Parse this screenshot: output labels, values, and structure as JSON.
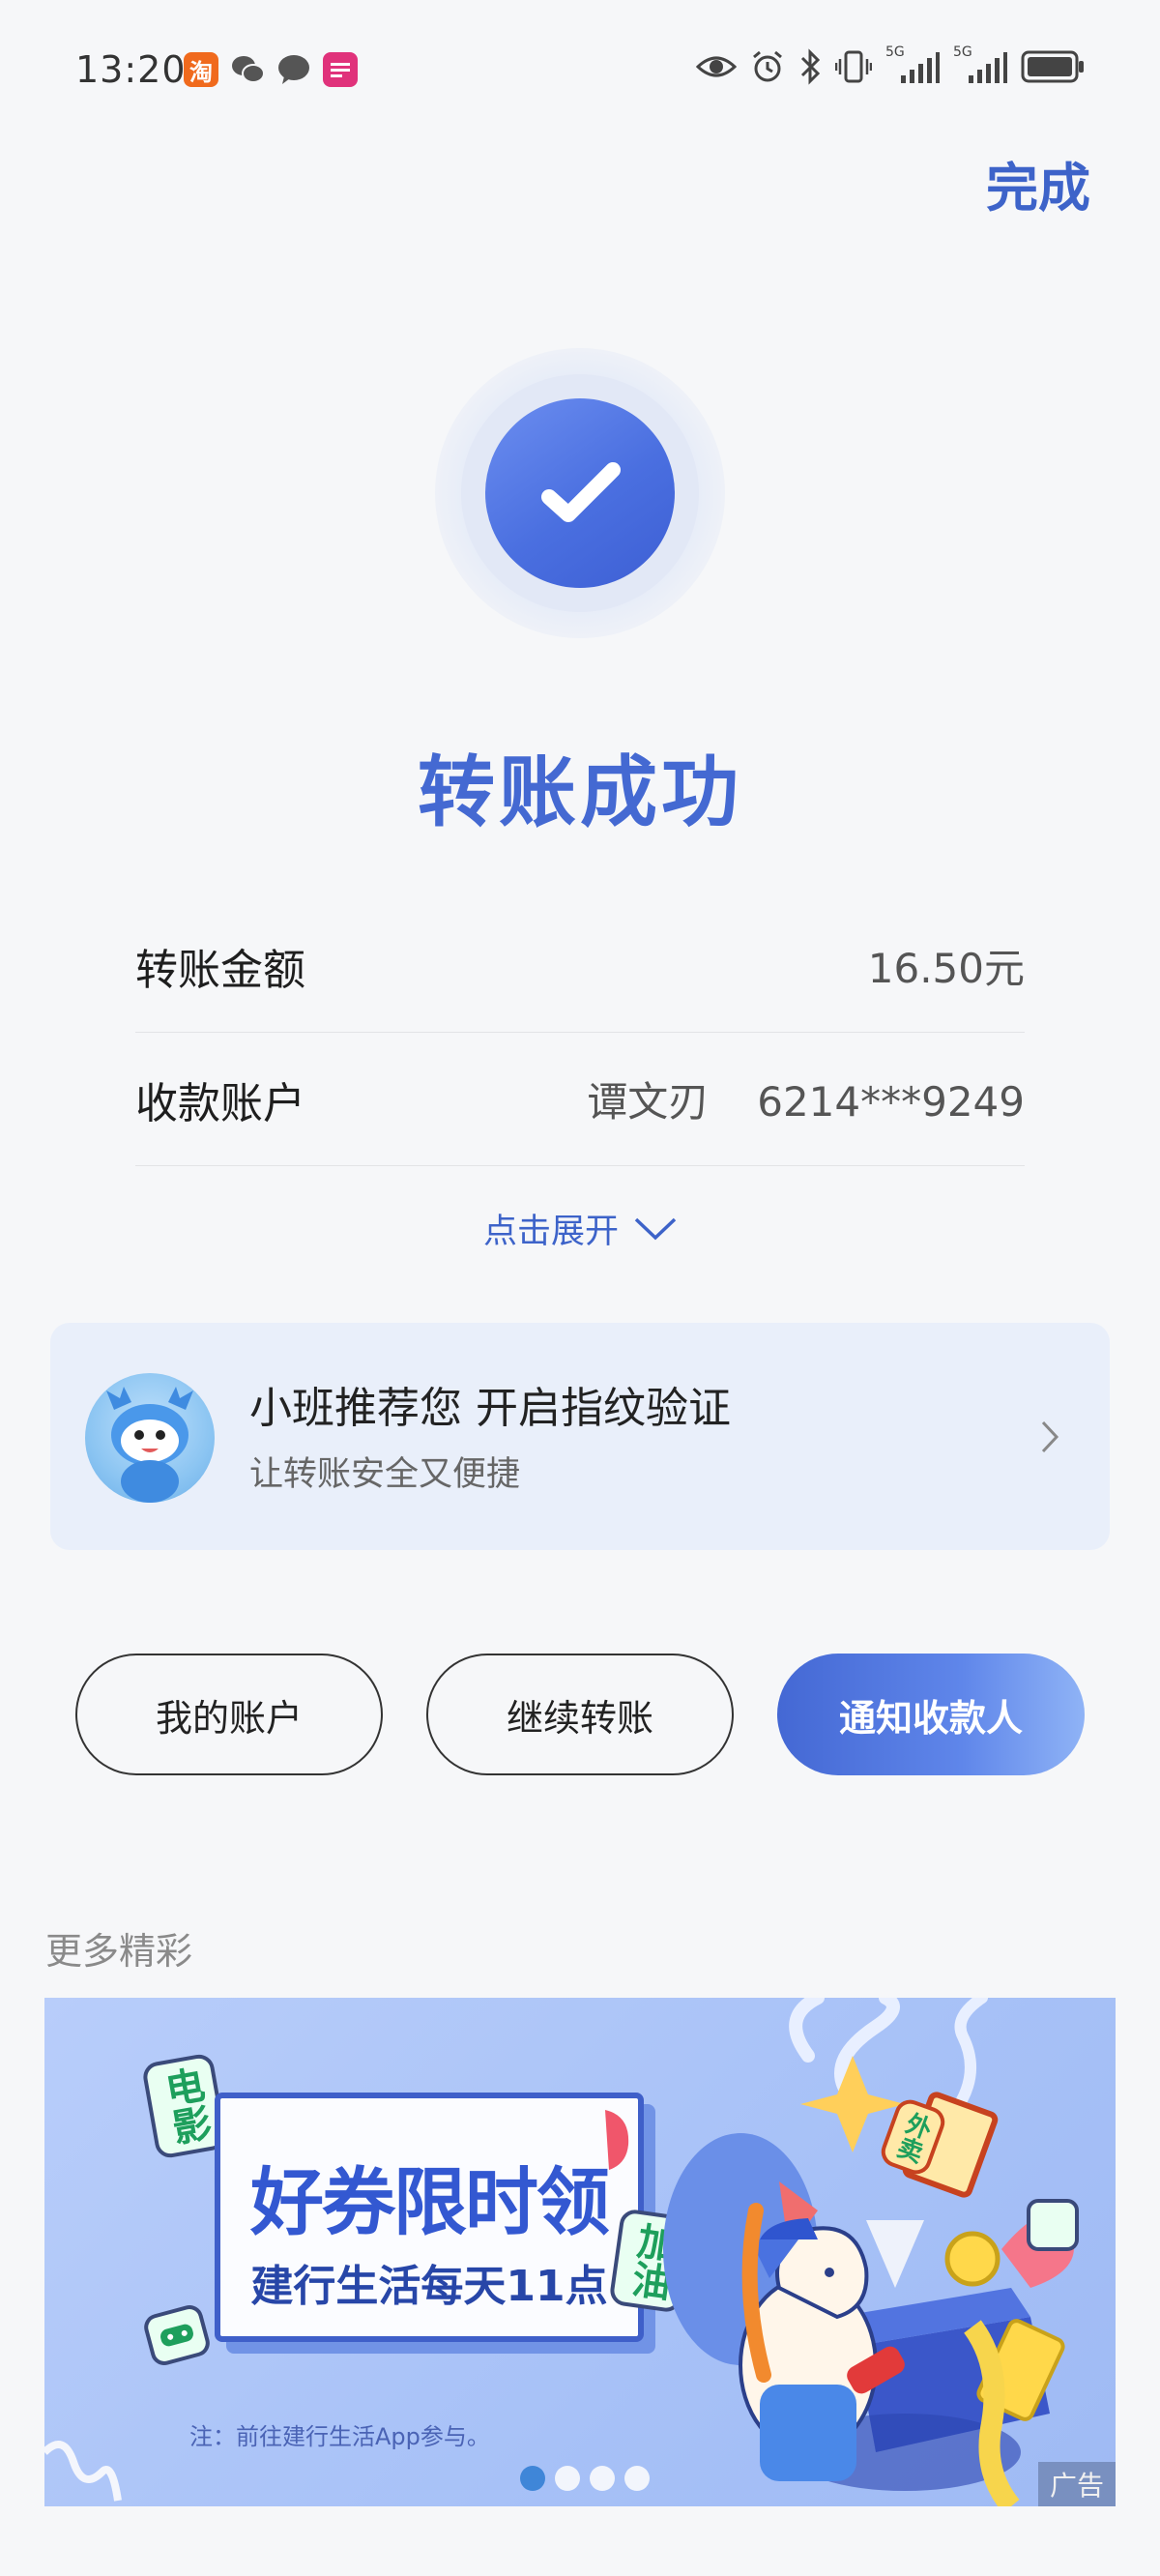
{
  "status_bar": {
    "time": "13:20",
    "app_icons": [
      "taobao-icon",
      "wechat-icon",
      "message-icon",
      "app-icon"
    ],
    "taobao_glyph": "淘",
    "network_5g_1": "5G",
    "network_5g_2": "5G"
  },
  "header": {
    "done_label": "完成"
  },
  "result": {
    "title": "转账成功"
  },
  "details": {
    "amount_label": "转账金额",
    "amount_value": "16.50元",
    "account_label": "收款账户",
    "account_name": "谭文刃",
    "account_number": "6214***9249",
    "expand_label": "点击展开"
  },
  "recommend": {
    "title": "小班推荐您 开启指纹验证",
    "subtitle": "让转账安全又便捷"
  },
  "actions": {
    "my_account": "我的账户",
    "continue_transfer": "继续转账",
    "notify_payee": "通知收款人"
  },
  "more": {
    "label": "更多精彩"
  },
  "banner": {
    "headline": "好券限时领",
    "subline": "建行生活每天11点",
    "tag_movie": "电影",
    "tag_fuel": "加油",
    "tag_takeout": "外卖",
    "note": "注：前往建行生活App参与。",
    "ad_label": "广告",
    "pages_total": 4,
    "active_page": 1
  },
  "colors": {
    "accent": "#3d63c9",
    "primary_button_start": "#4468d4",
    "primary_button_end": "#8fb3f6",
    "card_bg": "#e9effa",
    "banner_bg": "#a7c1f7"
  }
}
